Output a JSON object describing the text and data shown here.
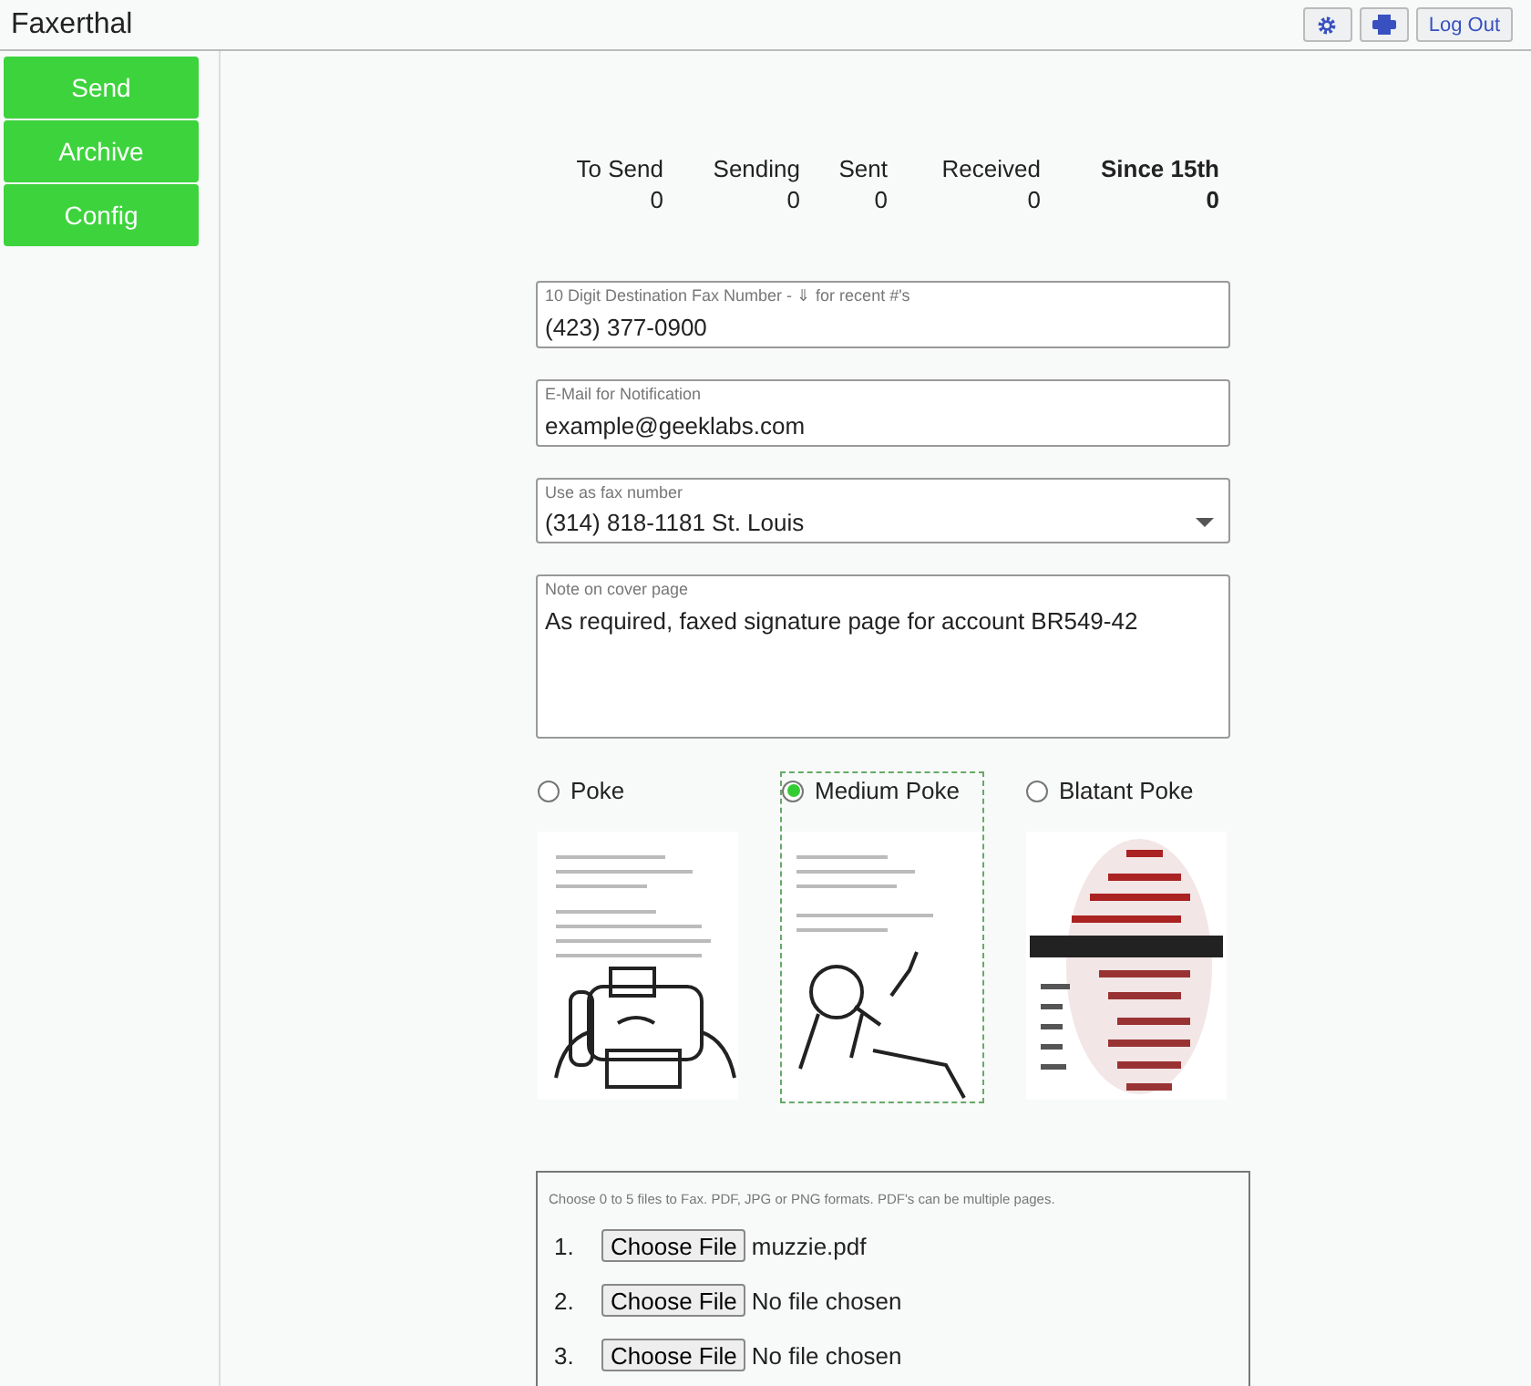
{
  "app": {
    "title": "Faxerthal",
    "logout": "Log Out"
  },
  "nav": [
    {
      "label": "Send"
    },
    {
      "label": "Archive"
    },
    {
      "label": "Config"
    }
  ],
  "stats": [
    {
      "label": "To Send",
      "value": "0",
      "emphasis": false
    },
    {
      "label": "Sending",
      "value": "0",
      "emphasis": false
    },
    {
      "label": "Sent",
      "value": "0",
      "emphasis": false
    },
    {
      "label": "Received",
      "value": "0",
      "emphasis": false
    },
    {
      "label": "Since 15th",
      "value": "0",
      "emphasis": true
    }
  ],
  "form": {
    "fax_number": {
      "label": "10 Digit Destination Fax Number - ⇓ for recent #'s",
      "value": "(423) 377-0900"
    },
    "email": {
      "label": "E-Mail for Notification",
      "value": "example@geeklabs.com"
    },
    "from_number": {
      "label": "Use as fax number",
      "value": "(314) 818-1181 St. Louis"
    },
    "note": {
      "label": "Note on cover page",
      "value": "As required, faxed signature page for account BR549-42"
    }
  },
  "styles": [
    {
      "label": "Poke",
      "selected": false
    },
    {
      "label": "Medium Poke",
      "selected": true
    },
    {
      "label": "Blatant Poke",
      "selected": false
    }
  ],
  "files": {
    "hint": "Choose 0 to 5 files to Fax. PDF, JPG or PNG formats. PDF's can be multiple pages.",
    "rows": [
      {
        "number": "1.",
        "button": "Choose File",
        "file": "muzzie.pdf"
      },
      {
        "number": "2.",
        "button": "Choose File",
        "file": "No file chosen"
      },
      {
        "number": "3.",
        "button": "Choose File",
        "file": "No file chosen"
      }
    ]
  }
}
